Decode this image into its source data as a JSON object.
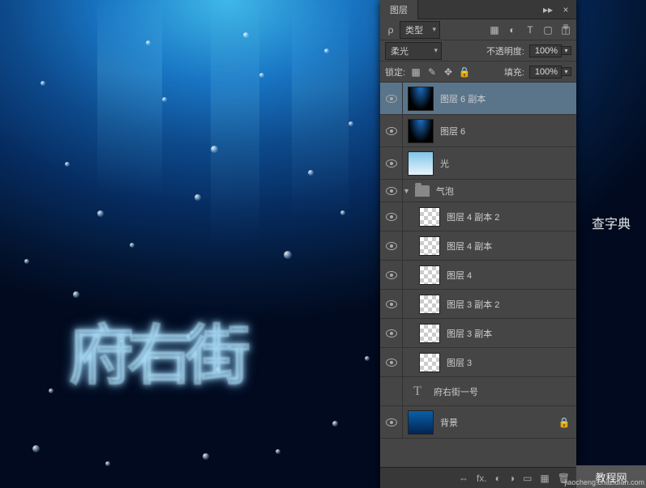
{
  "canvas": {
    "bubble_text": "府右街"
  },
  "panel": {
    "title": "图层",
    "menu_icon": "≡",
    "collapse_icon": "▸▸",
    "close_icon": "×",
    "filter": {
      "label": "ρ",
      "kind_label": "类型"
    },
    "blend": {
      "mode": "柔光",
      "opacity_label": "不透明度:",
      "opacity_value": "100%"
    },
    "lock": {
      "label": "锁定:",
      "fill_label": "填充:",
      "fill_value": "100%"
    },
    "layers": [
      {
        "name": "图层 6 副本",
        "thumb": "dark",
        "selected": true,
        "visible": true
      },
      {
        "name": "图层 6",
        "thumb": "dark",
        "visible": true
      },
      {
        "name": "光",
        "thumb": "light",
        "visible": true
      },
      {
        "name": "气泡",
        "group": true,
        "expanded": true,
        "visible": true
      },
      {
        "name": "图层 4 副本 2",
        "thumb": "check",
        "indent": 1,
        "visible": true
      },
      {
        "name": "图层 4 副本",
        "thumb": "check",
        "indent": 1,
        "visible": true
      },
      {
        "name": "图层 4",
        "thumb": "check",
        "indent": 1,
        "visible": true
      },
      {
        "name": "图层 3 副本 2",
        "thumb": "check",
        "indent": 1,
        "visible": true
      },
      {
        "name": "图层 3 副本",
        "thumb": "check",
        "indent": 1,
        "visible": true
      },
      {
        "name": "图层 3",
        "thumb": "check",
        "indent": 1,
        "visible": true
      },
      {
        "name": "府右街一号",
        "type": "text",
        "visible": false
      },
      {
        "name": "背景",
        "thumb": "bg",
        "visible": true,
        "locked": true
      }
    ],
    "footer_icons": {
      "link": "⇔",
      "fx": "fx.",
      "mask": "◐",
      "adjust": "◑",
      "folder": "▭",
      "new": "▦",
      "trash": "🗑"
    }
  },
  "watermarks": {
    "side": "查字典",
    "bottom": "教程网",
    "url": "jiaocheng.chazidian.com"
  }
}
